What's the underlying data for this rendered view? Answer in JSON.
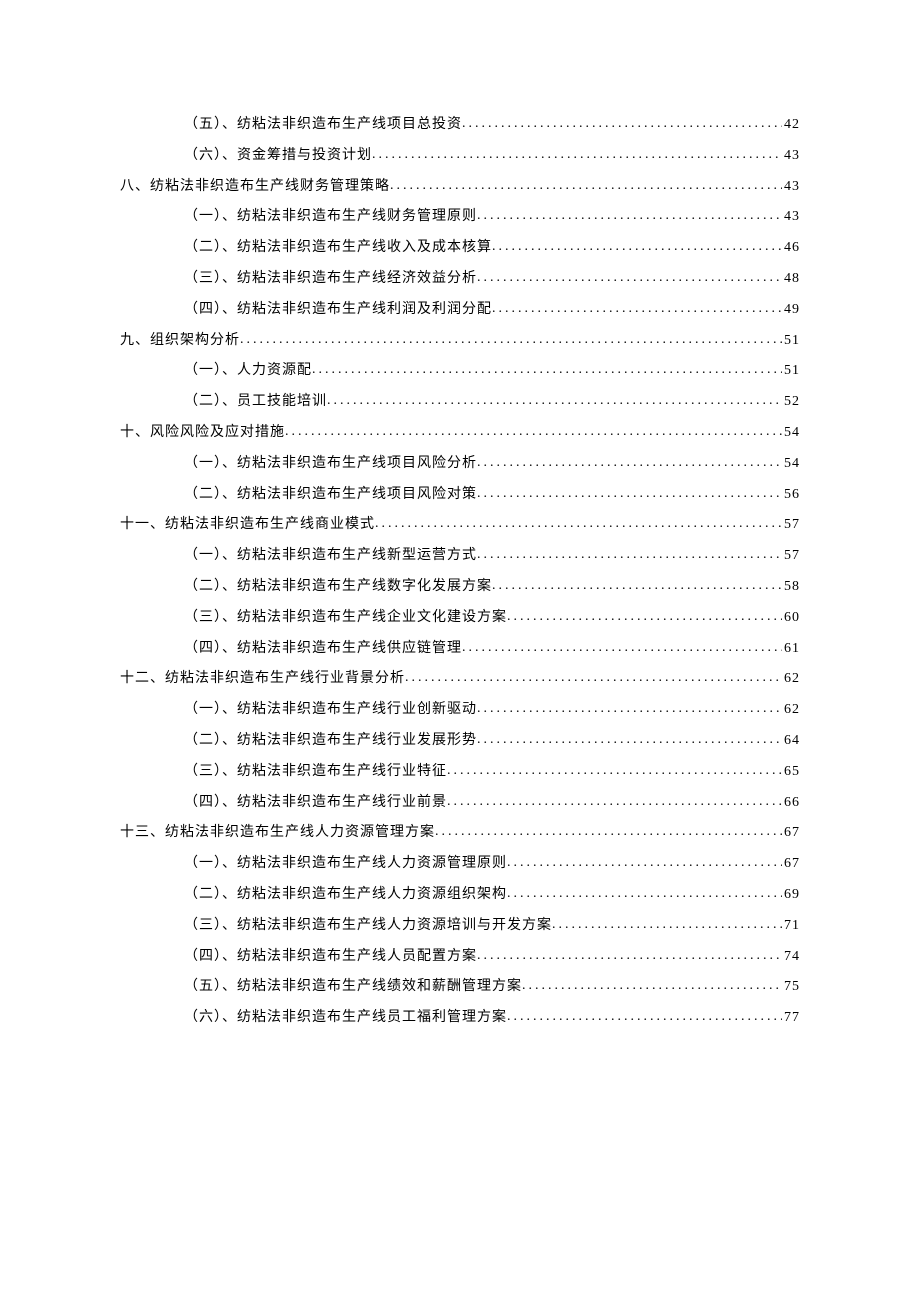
{
  "toc": [
    {
      "level": 1,
      "text": "（五）、纺粘法非织造布生产线项目总投资",
      "page": "42"
    },
    {
      "level": 1,
      "text": "（六）、资金筹措与投资计划",
      "page": "43"
    },
    {
      "level": 0,
      "text": "八、纺粘法非织造布生产线财务管理策略",
      "page": "43"
    },
    {
      "level": 1,
      "text": "（一）、纺粘法非织造布生产线财务管理原则",
      "page": "43"
    },
    {
      "level": 1,
      "text": "（二）、纺粘法非织造布生产线收入及成本核算",
      "page": "46"
    },
    {
      "level": 1,
      "text": "（三）、纺粘法非织造布生产线经济效益分析",
      "page": "48"
    },
    {
      "level": 1,
      "text": "（四）、纺粘法非织造布生产线利润及利润分配",
      "page": "49"
    },
    {
      "level": 0,
      "text": "九、组织架构分析",
      "page": "51"
    },
    {
      "level": 1,
      "text": "（一）、人力资源配",
      "page": "51"
    },
    {
      "level": 1,
      "text": "（二）、员工技能培训",
      "page": "52"
    },
    {
      "level": 0,
      "text": "十、风险风险及应对措施",
      "page": "54"
    },
    {
      "level": 1,
      "text": "（一）、纺粘法非织造布生产线项目风险分析",
      "page": "54"
    },
    {
      "level": 1,
      "text": "（二）、纺粘法非织造布生产线项目风险对策",
      "page": "56"
    },
    {
      "level": 0,
      "text": "十一、纺粘法非织造布生产线商业模式",
      "page": "57"
    },
    {
      "level": 1,
      "text": "（一）、纺粘法非织造布生产线新型运营方式",
      "page": "57"
    },
    {
      "level": 1,
      "text": "（二）、纺粘法非织造布生产线数字化发展方案",
      "page": "58"
    },
    {
      "level": 1,
      "text": "（三）、纺粘法非织造布生产线企业文化建设方案",
      "page": "60"
    },
    {
      "level": 1,
      "text": "（四）、纺粘法非织造布生产线供应链管理",
      "page": "61"
    },
    {
      "level": 0,
      "text": "十二、纺粘法非织造布生产线行业背景分析",
      "page": "62"
    },
    {
      "level": 1,
      "text": "（一）、纺粘法非织造布生产线行业创新驱动",
      "page": "62"
    },
    {
      "level": 1,
      "text": "（二）、纺粘法非织造布生产线行业发展形势",
      "page": "64"
    },
    {
      "level": 1,
      "text": "（三）、纺粘法非织造布生产线行业特征",
      "page": "65"
    },
    {
      "level": 1,
      "text": "（四）、纺粘法非织造布生产线行业前景",
      "page": "66"
    },
    {
      "level": 0,
      "text": "十三、纺粘法非织造布生产线人力资源管理方案",
      "page": "67"
    },
    {
      "level": 1,
      "text": "（一）、纺粘法非织造布生产线人力资源管理原则",
      "page": "67"
    },
    {
      "level": 1,
      "text": "（二）、纺粘法非织造布生产线人力资源组织架构",
      "page": "69"
    },
    {
      "level": 1,
      "text": "（三）、纺粘法非织造布生产线人力资源培训与开发方案",
      "page": "71"
    },
    {
      "level": 1,
      "text": "（四）、纺粘法非织造布生产线人员配置方案",
      "page": "74"
    },
    {
      "level": 1,
      "text": "（五）、纺粘法非织造布生产线绩效和薪酬管理方案",
      "page": "75"
    },
    {
      "level": 1,
      "text": "（六）、纺粘法非织造布生产线员工福利管理方案",
      "page": "77"
    }
  ]
}
